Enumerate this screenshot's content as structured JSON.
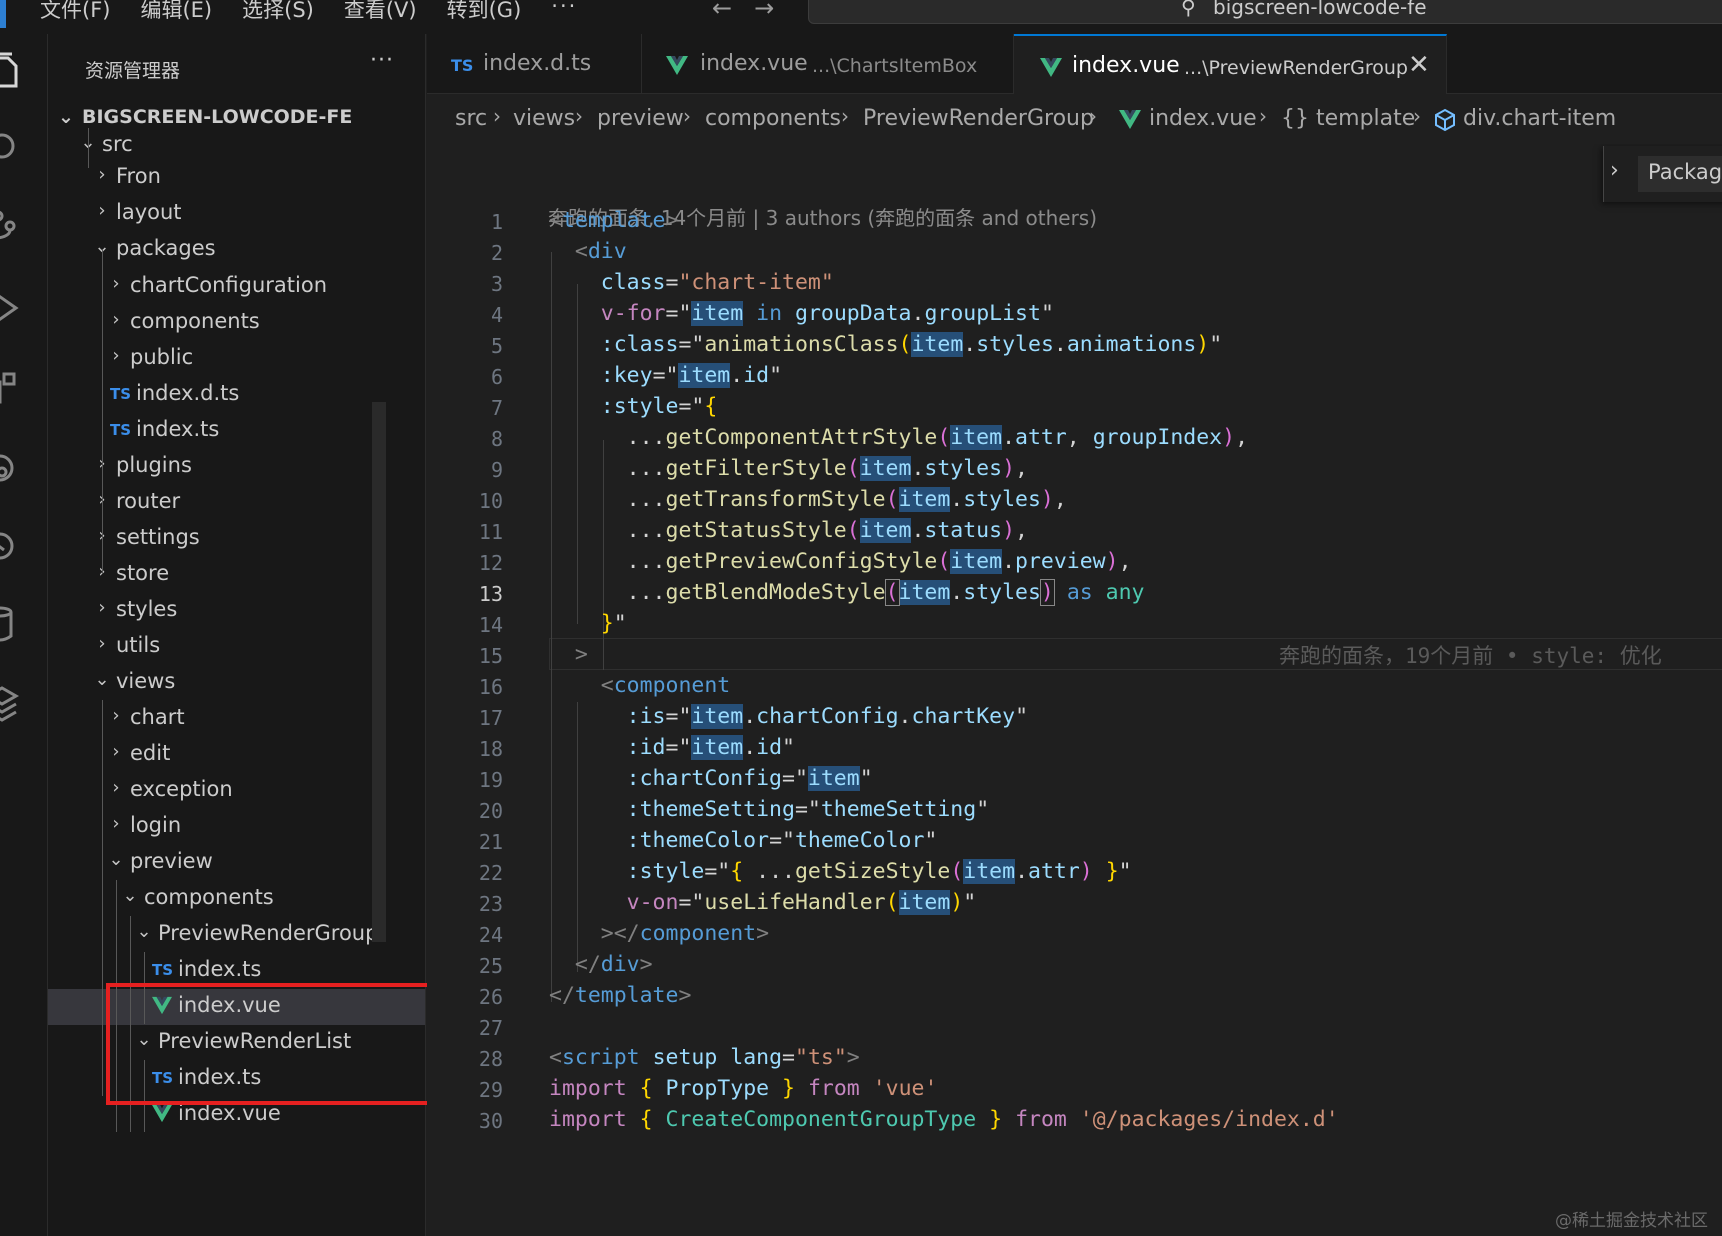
{
  "menu": [
    "文件(F)",
    "编辑(E)",
    "选择(S)",
    "查看(V)",
    "转到(G)",
    "···"
  ],
  "search": {
    "label": "bigscreen-lowcode-fe"
  },
  "sidebar": {
    "title": "资源管理器",
    "more": "···",
    "project": "BIGSCREEN-LOWCODE-FE",
    "rows": [
      {
        "label": "src",
        "kind": "folder-open"
      },
      {
        "label": "Fron",
        "kind": "folder"
      },
      {
        "label": "layout",
        "kind": "folder"
      },
      {
        "label": "packages",
        "kind": "folder-open"
      },
      {
        "label": "chartConfiguration",
        "kind": "folder"
      },
      {
        "label": "components",
        "kind": "folder"
      },
      {
        "label": "public",
        "kind": "folder"
      },
      {
        "label": "index.d.ts",
        "kind": "ts"
      },
      {
        "label": "index.ts",
        "kind": "ts"
      },
      {
        "label": "plugins",
        "kind": "folder"
      },
      {
        "label": "router",
        "kind": "folder"
      },
      {
        "label": "settings",
        "kind": "folder"
      },
      {
        "label": "store",
        "kind": "folder"
      },
      {
        "label": "styles",
        "kind": "folder"
      },
      {
        "label": "utils",
        "kind": "folder"
      },
      {
        "label": "views",
        "kind": "folder-open"
      },
      {
        "label": "chart",
        "kind": "folder"
      },
      {
        "label": "edit",
        "kind": "folder"
      },
      {
        "label": "exception",
        "kind": "folder"
      },
      {
        "label": "login",
        "kind": "folder"
      },
      {
        "label": "preview",
        "kind": "folder-open"
      },
      {
        "label": "components",
        "kind": "folder-open"
      },
      {
        "label": "PreviewRenderGroup",
        "kind": "folder-open"
      },
      {
        "label": "index.ts",
        "kind": "ts"
      },
      {
        "label": "index.vue",
        "kind": "vue",
        "selected": true
      },
      {
        "label": "PreviewRenderList",
        "kind": "folder-open"
      },
      {
        "label": "index.ts",
        "kind": "ts"
      },
      {
        "label": "index.vue",
        "kind": "vue"
      }
    ]
  },
  "tabs": [
    {
      "name": "index.d.ts",
      "desc": "",
      "kind": "ts"
    },
    {
      "name": "index.vue",
      "desc": "...\\ChartsItemBox",
      "kind": "vue"
    },
    {
      "name": "index.vue",
      "desc": "...\\PreviewRenderGroup",
      "kind": "vue",
      "active": true,
      "close": "✕"
    }
  ],
  "breadcrumb": [
    "src",
    "views",
    "preview",
    "components",
    "PreviewRenderGroup",
    "index.vue",
    "{} template",
    "div.chart-item"
  ],
  "outline": {
    "label": "Packag"
  },
  "editor": {
    "blame": "奔跑的面条, 14个月前 | 3 authors (奔跑的面条 and others)",
    "inline_blame": "奔跑的面条，19个月前 • style: 优化",
    "current_line": "13",
    "line_numbers": [
      "1",
      "2",
      "3",
      "4",
      "5",
      "6",
      "7",
      "8",
      "9",
      "10",
      "11",
      "12",
      "13",
      "14",
      "15",
      "16",
      "17",
      "18",
      "19",
      "20",
      "21",
      "22",
      "23",
      "24",
      "25",
      "26",
      "27",
      "28",
      "29",
      "30"
    ]
  },
  "watermark": "@稀土掘金技术社区",
  "colors": {
    "accent": "#0078d4",
    "highlight": "#e62020",
    "vue": "#41b883",
    "ts": "#3b8eea"
  }
}
